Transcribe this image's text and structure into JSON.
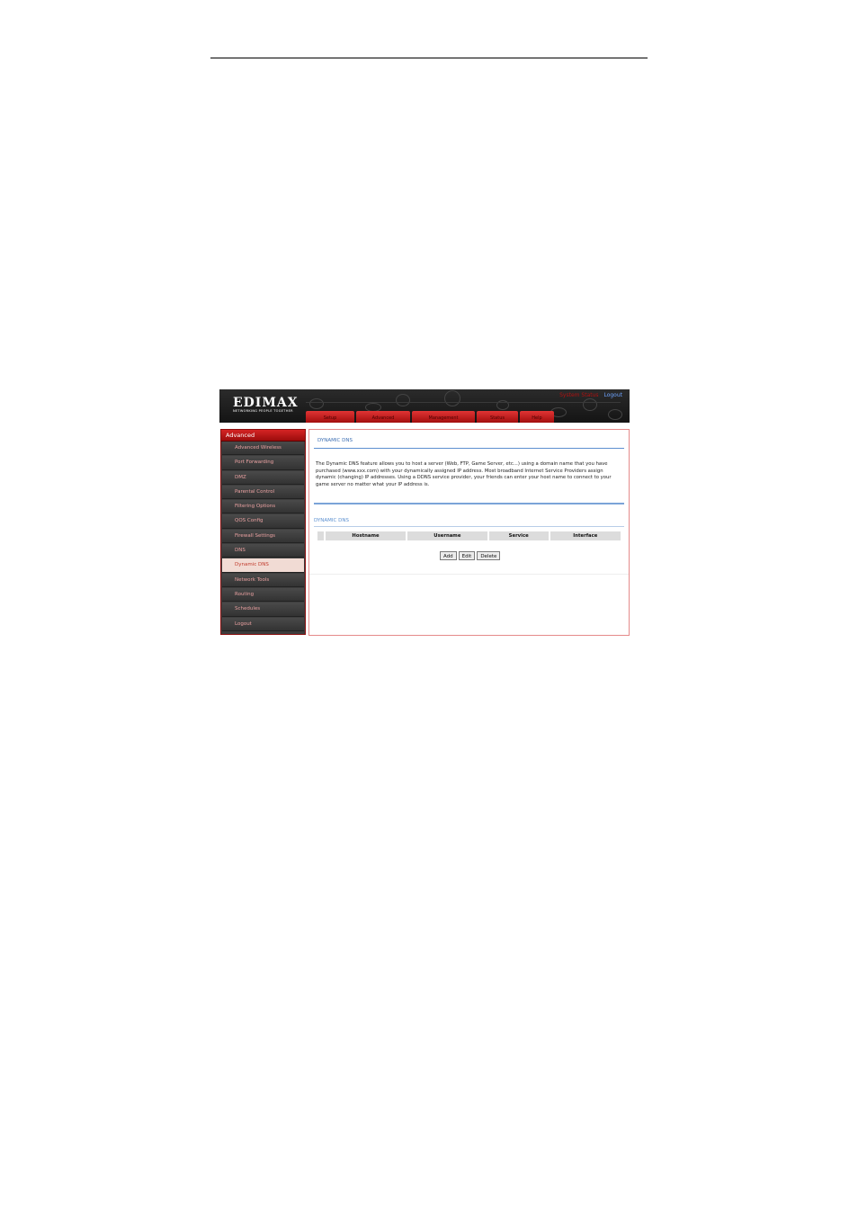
{
  "header": {
    "logo_text": "EDIMAX",
    "tagline": "NETWORKING PEOPLE TOGETHER",
    "link_system": "System Status",
    "link_logout": "Logout",
    "tabs": [
      "Setup",
      "Advanced",
      "Management",
      "Status",
      "Help"
    ]
  },
  "sidebar": {
    "section": "Advanced",
    "items": [
      "Advanced Wireless",
      "Port Forwarding",
      "DMZ",
      "Parental Control",
      "Filtering Options",
      "QOS Config",
      "Firewall Settings",
      "DNS",
      "Dynamic DNS",
      "Network Tools",
      "Routing",
      "Schedules",
      "Logout"
    ],
    "active_item": "Dynamic DNS"
  },
  "main": {
    "title": "DYNAMIC DNS",
    "description": "The Dynamic DNS feature allows you to host a server (Web, FTP, Game Server, etc...) using a domain name that you have purchased (www.xxx.com) with your dynamically assigned IP address. Most broadband Internet Service Providers assign dynamic (changing) IP addresses. Using a DDNS service provider, your friends can enter your host name to connect to your game server no matter what your IP address is.",
    "section_title": "DYNAMIC DNS",
    "table_headers": [
      "Hostname",
      "Username",
      "Service",
      "Interface"
    ],
    "buttons": {
      "add": "Add",
      "edit": "Edit",
      "delete": "Delete"
    }
  },
  "colors": {
    "accent_red": "#c8121a",
    "link_blue": "#3d6fb3",
    "sidebar_dark": "#3d3d3d"
  }
}
